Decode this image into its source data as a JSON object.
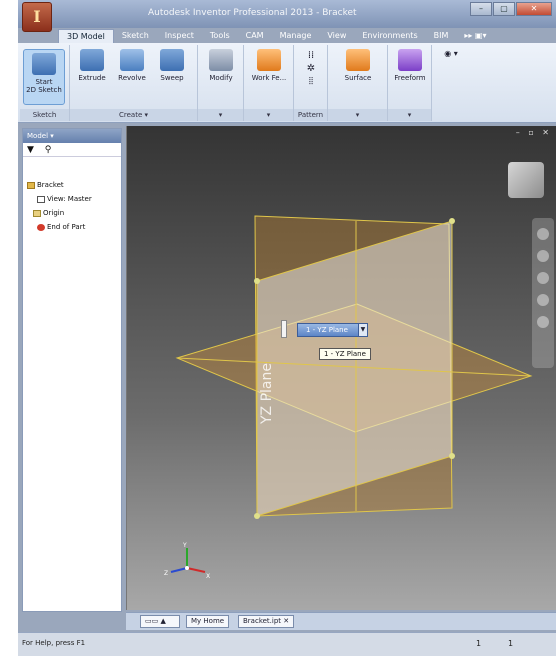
{
  "window": {
    "title": "Autodesk Inventor Professional 2013 - Bracket",
    "app_logo_letter": "I",
    "controls": [
      "–",
      "▢",
      "✕"
    ]
  },
  "ribbon_tabs": [
    {
      "label": "3D Model",
      "active": true
    },
    {
      "label": "Sketch"
    },
    {
      "label": "Inspect"
    },
    {
      "label": "Tools"
    },
    {
      "label": "CAM"
    },
    {
      "label": "Manage"
    },
    {
      "label": "View"
    },
    {
      "label": "Environments"
    },
    {
      "label": "BIM"
    },
    {
      "label": "▸▸ ▣▾"
    }
  ],
  "ribbon": {
    "sketch_group": {
      "label": "Sketch",
      "tool": "Start\n2D Sketch"
    },
    "create_group": {
      "label": "Create ▾",
      "tools": [
        "Extrude",
        "Revolve",
        "Sweep"
      ]
    },
    "modify_group": {
      "label": "▾",
      "tool": "Modify"
    },
    "work_group": {
      "label": "▾",
      "tool": "Work Fe..."
    },
    "pattern_group": {
      "label": "Pattern"
    },
    "surface_group": {
      "label": "▾",
      "tool": "Surface"
    },
    "freeform_group": {
      "label": "▾",
      "tool": "Freeform"
    }
  },
  "browser": {
    "header": "Model ▾",
    "tree": [
      "Bracket",
      "View: Master",
      "Origin",
      "End of Part"
    ]
  },
  "viewport": {
    "controls": "– ▫ ✕",
    "plane_chip": "1 - YZ Plane",
    "tooltip": "1 - YZ Plane",
    "plane_watermark": "YZ Plane",
    "triad": {
      "x": "X",
      "y": "Y",
      "z": "Z"
    }
  },
  "doc_tabs": [
    "My Home",
    "Bracket.ipt"
  ],
  "status": {
    "help": "For Help, press F1",
    "count_a": "1",
    "count_b": "1"
  },
  "colors": {
    "plane_yellow": "#e0c64a",
    "plane_orange": "#b07a2e",
    "plane_white": "#f0f0f0",
    "accent_blue": "#5d86c7"
  }
}
